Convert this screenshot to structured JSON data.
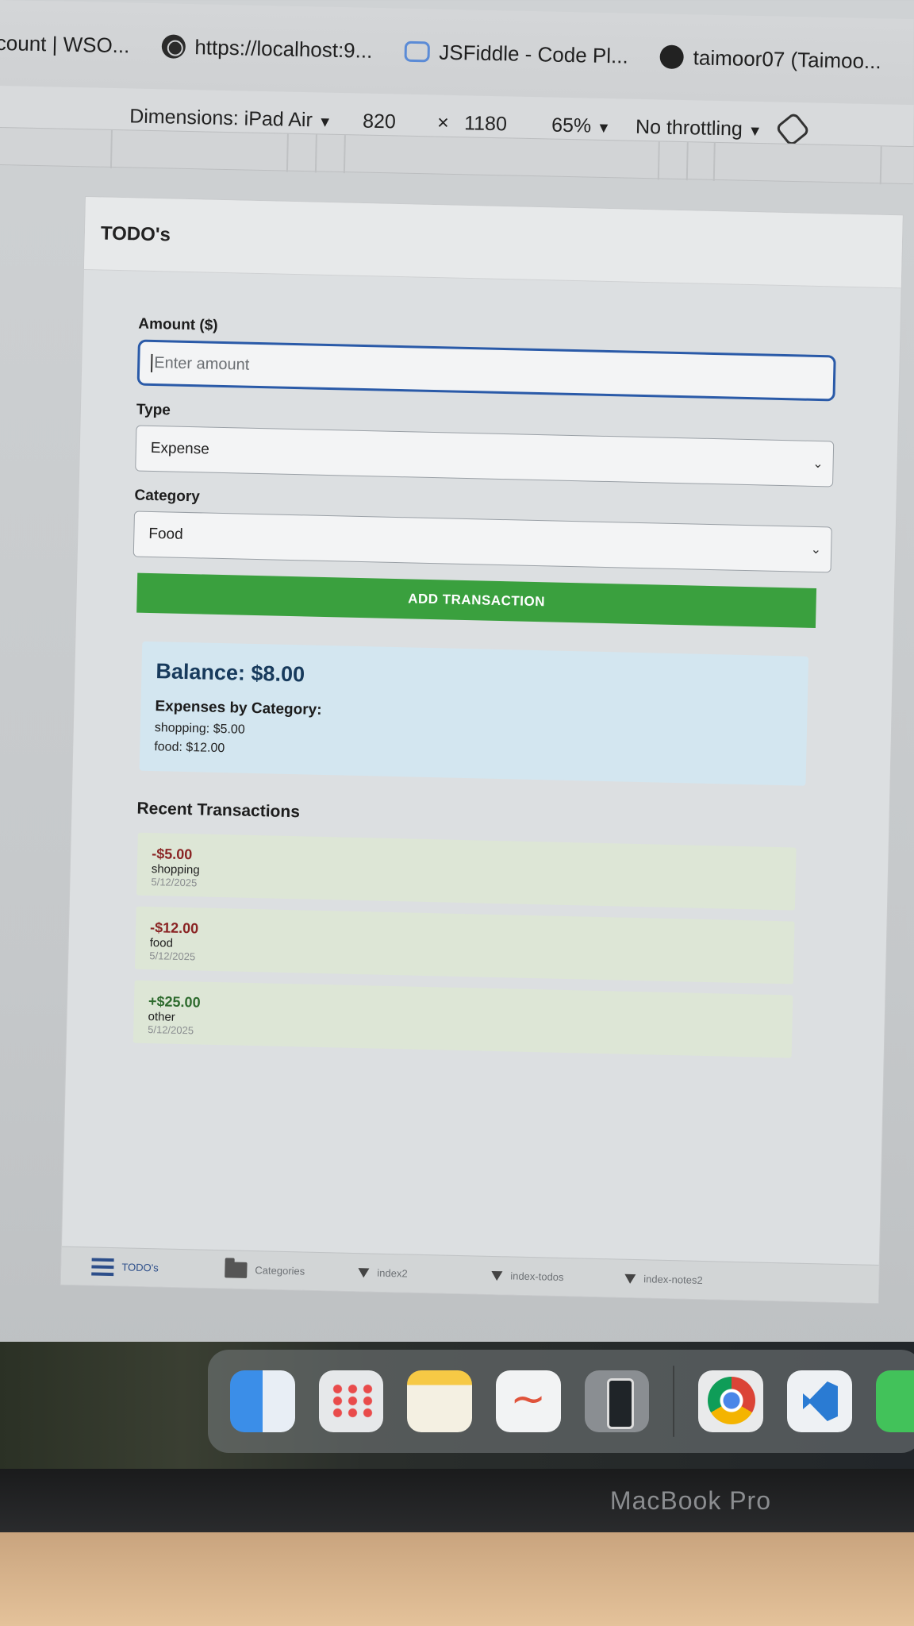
{
  "bookmarks": [
    {
      "label": "count | WSO...",
      "icon": "none"
    },
    {
      "label": "https://localhost:9...",
      "icon": "globe-icon"
    },
    {
      "label": "JSFiddle - Code Pl...",
      "icon": "jsfiddle-icon"
    },
    {
      "label": "taimoor07 (Taimoo...",
      "icon": "github-icon"
    }
  ],
  "devtools": {
    "dimensions_label": "Dimensions: iPad Air",
    "width": "820",
    "times": "×",
    "height": "1180",
    "zoom": "65%",
    "throttling": "No throttling"
  },
  "app": {
    "header_title": "TODO's",
    "amount_label": "Amount ($)",
    "amount_placeholder": "Enter amount",
    "type_label": "Type",
    "type_value": "Expense",
    "category_label": "Category",
    "category_value": "Food",
    "add_button": "ADD TRANSACTION",
    "balance": "Balance: $8.00",
    "expenses_heading": "Expenses by Category:",
    "expenses": [
      "shopping: $5.00",
      "food: $12.00"
    ],
    "recent_heading": "Recent Transactions",
    "transactions": [
      {
        "amount": "-$5.00",
        "category": "shopping",
        "date": "5/12/2025",
        "kind": "negative"
      },
      {
        "amount": "-$12.00",
        "category": "food",
        "date": "5/12/2025",
        "kind": "negative"
      },
      {
        "amount": "+$25.00",
        "category": "other",
        "date": "5/12/2025",
        "kind": "positive"
      }
    ],
    "tabs": [
      {
        "label": "TODO's",
        "icon": "list-icon",
        "active": true
      },
      {
        "label": "Categories",
        "icon": "folder-icon",
        "active": false
      },
      {
        "label": "index2",
        "icon": "triangle-icon",
        "active": false
      },
      {
        "label": "index-todos",
        "icon": "triangle-icon",
        "active": false
      },
      {
        "label": "index-notes2",
        "icon": "triangle-icon",
        "active": false
      }
    ]
  },
  "dock": [
    "finder-icon",
    "launchpad-icon",
    "notes-icon",
    "freeform-icon",
    "ipad-simulator-icon",
    "chrome-icon",
    "vscode-icon",
    "messages-icon"
  ],
  "bezel_text": "MacBook Pro",
  "colors": {
    "accent_green": "#3aa03e",
    "focus_blue": "#2a5aa8",
    "negative": "#8a2424",
    "positive": "#2e6b2e",
    "balance_bg": "#d3e6f0"
  }
}
